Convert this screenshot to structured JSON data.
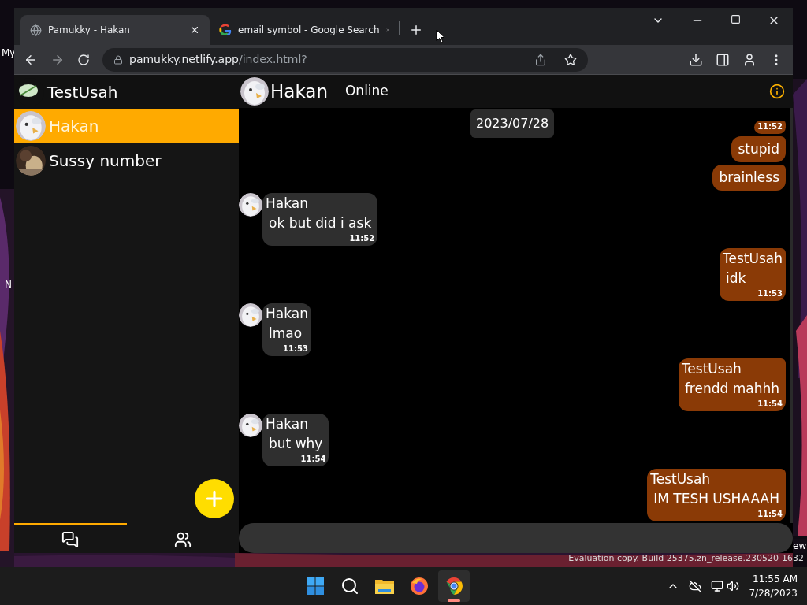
{
  "desktop": {
    "left_labels": [
      "My",
      "N"
    ],
    "right_label": "ew",
    "watermark": "Evaluation copy. Build 25375.zn_release.230520-1632"
  },
  "browser": {
    "tabs": [
      {
        "title": "Pamukky - Hakan",
        "selected": true
      },
      {
        "title": "email symbol - Google Search",
        "selected": false
      }
    ],
    "url": {
      "host": "pamukky.netlify.app",
      "path": "/index.html?"
    }
  },
  "sidebar": {
    "user_name": "TestUsah",
    "contacts": [
      {
        "name": "Hakan",
        "selected": true
      },
      {
        "name": "Sussy number",
        "selected": false
      }
    ],
    "nav": [
      {
        "kind": "chats",
        "selected": true
      },
      {
        "kind": "contacts",
        "selected": false
      }
    ]
  },
  "chat": {
    "name": "Hakan",
    "status": "Online",
    "date": "2023/07/28",
    "messages": [
      {
        "kind": "out",
        "time": "11:52"
      },
      {
        "kind": "out",
        "text": "stupid"
      },
      {
        "kind": "out",
        "text": "brainless"
      },
      {
        "kind": "in",
        "sender": "Hakan",
        "text": "ok but did i ask",
        "time": "11:52"
      },
      {
        "kind": "out",
        "sender": "TestUsah",
        "text": "idk",
        "time": "11:53"
      },
      {
        "kind": "in",
        "sender": "Hakan",
        "text": "lmao",
        "time": "11:53"
      },
      {
        "kind": "out",
        "sender": "TestUsah",
        "text": "frendd mahhh",
        "time": "11:54"
      },
      {
        "kind": "in",
        "sender": "Hakan",
        "text": "but why",
        "time": "11:54"
      },
      {
        "kind": "out",
        "sender": "TestUsah",
        "text": "IM TESH USHAAAH",
        "time": "11:54"
      }
    ]
  },
  "taskbar": {
    "apps": [
      {
        "kind": "start",
        "selected": false
      },
      {
        "kind": "search",
        "selected": false
      },
      {
        "kind": "files",
        "selected": false
      },
      {
        "kind": "firefox",
        "selected": false
      },
      {
        "kind": "chrome",
        "selected": true
      }
    ],
    "time": "11:55 AM",
    "date": "7/28/2023"
  }
}
